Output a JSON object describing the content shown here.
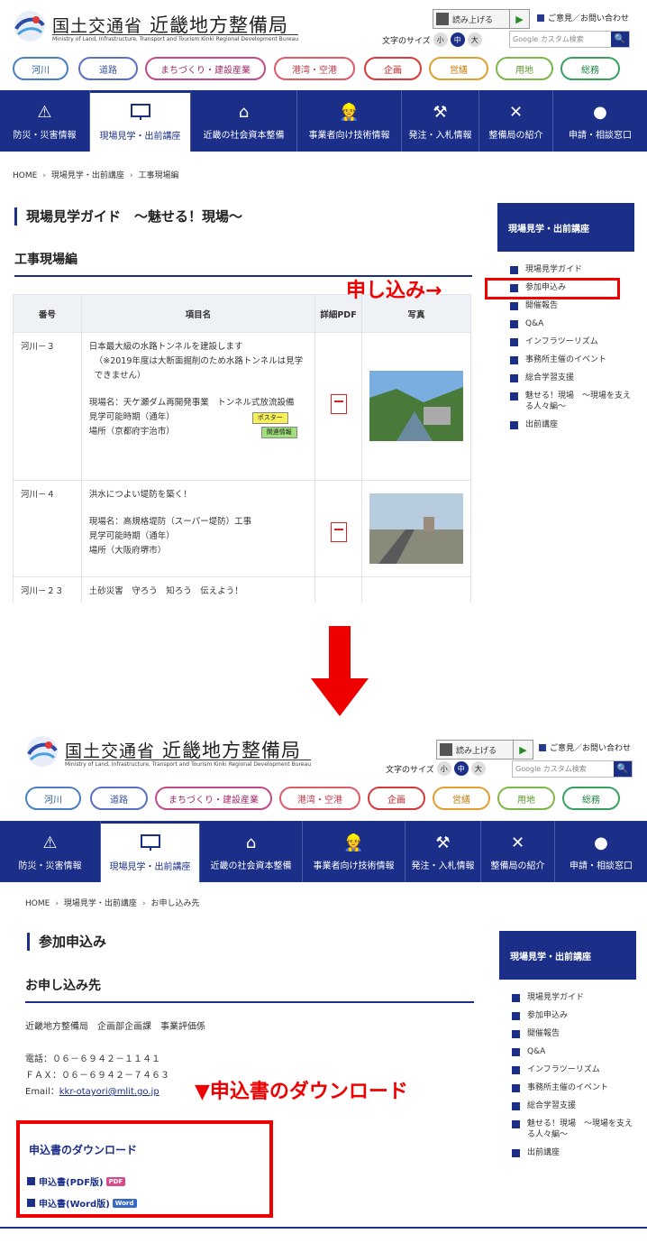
{
  "header": {
    "org": "国土交通省",
    "bureau": "近畿地方整備局",
    "sub": "Ministry of Land, Infrastructure, Transport and Tourism Kinki Regional Development Bureau",
    "read_aloud": "読み上げる",
    "opinion": "ご意見／お問い合わせ",
    "font_size_label": "文字のサイズ",
    "font_sizes": [
      "小",
      "中",
      "大"
    ],
    "search_placeholder": "Google カスタム検索"
  },
  "pills": [
    "河川",
    "道路",
    "まちづくり・建設産業",
    "港湾・空港",
    "企画",
    "営繕",
    "用地",
    "総務"
  ],
  "pill_colors": [
    "#4a7fc1",
    "#5a6fc1",
    "#c04a8a",
    "#e05a6a",
    "#d83a3a",
    "#e0a030",
    "#7ab84a",
    "#3aa060"
  ],
  "nav": [
    "防災・災害情報",
    "現場見学・出前講座",
    "近畿の社会資本整備",
    "事業者向け技術情報",
    "発注・入札情報",
    "整備局の紹介",
    "申請・相談窓口"
  ],
  "shot1": {
    "breadcrumb": [
      "HOME",
      "現場見学・出前講座",
      "工事現場編"
    ],
    "title": "現場見学ガイド　～魅せる！現場～",
    "section": "工事現場編",
    "callout": "申し込み→",
    "table": {
      "headers": [
        "番号",
        "項目名",
        "詳細PDF",
        "写真"
      ],
      "rows": [
        {
          "no": "河川－３",
          "title": "日本最大級の水路トンネルを建設します",
          "note": "（※2019年度は大断面掘削のため水路トンネルは見学できません）",
          "site": "現場名：天ケ瀬ダム再開発事業　トンネル式放流設備",
          "period": "見学可能時期（通年）",
          "place": "場所（京都府宇治市）",
          "badge1": "ポスター",
          "badge2": "関連情報"
        },
        {
          "no": "河川－４",
          "title": "洪水につよい堤防を築く！",
          "site": "現場名：高規格堤防（スーパー堤防）工事",
          "period": "見学可能時期（通年）",
          "place": "場所（大阪府堺市）"
        },
        {
          "no": "河川－２３",
          "title": "土砂災害　守ろう　知ろう　伝えよう！"
        }
      ]
    }
  },
  "sidebar": {
    "heading": "現場見学・出前講座",
    "items": [
      "現場見学ガイド",
      "参加申込み",
      "開催報告",
      "Q&A",
      "インフラツーリズム",
      "事務所主催のイベント",
      "総合学習支援",
      "魅せる！現場　～現場を支える人々編～",
      "出前講座"
    ]
  },
  "shot2": {
    "breadcrumb": [
      "HOME",
      "現場見学・出前講座",
      "お申し込み先"
    ],
    "title": "参加申込み",
    "section": "お申し込み先",
    "office": "近畿地方整備局　企画部企画課　事業評価係",
    "tel": "電話：０６－６９４２－１１４１",
    "fax": "ＦＡＸ：０６－６９４２－７４６３",
    "email_label": "Email：",
    "email": "kkr-otayori@mlit.go.jp",
    "callout": "▼申込書のダウンロード",
    "download": {
      "heading": "申込書のダウンロード",
      "pdf_label": "申込書(PDF版)",
      "pdf_tag": "PDF",
      "word_label": "申込書(Word版)",
      "word_tag": "Word"
    }
  },
  "accent_color": "#1b2f88",
  "callout_color": "#e00000"
}
